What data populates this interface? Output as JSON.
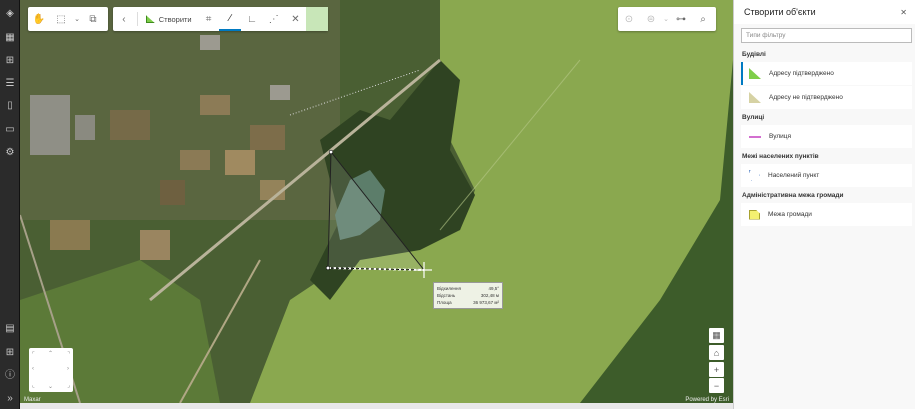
{
  "window": {
    "title": "Створити об'єкти"
  },
  "toolbar_create": {
    "label": "Створити"
  },
  "panel": {
    "title": "Створити об'єкти",
    "close_icon": "close-icon",
    "filter_placeholder": "Типи фільтру",
    "groups": [
      {
        "name": "Будівлі",
        "items": [
          {
            "label": "Адресу підтверджено",
            "swatch": "#7fce4a",
            "selected": true
          },
          {
            "label": "Адресу не підтверджено",
            "swatch": "#d6d2a4",
            "selected": false
          }
        ]
      },
      {
        "name": "Вулиці",
        "items": [
          {
            "label": "Вулиця",
            "swatch": "#d36fd0"
          }
        ]
      },
      {
        "name": "Межі населених пунктів",
        "items": [
          {
            "label": "Населений пункт",
            "swatch": "#4b7cc4"
          }
        ]
      },
      {
        "name": "Адміністративна межа громади",
        "items": [
          {
            "label": "Межа громади",
            "swatch": "#f4f070"
          }
        ]
      }
    ]
  },
  "measure": {
    "rows": [
      {
        "k": "Відхилення",
        "v": "49,5°"
      },
      {
        "k": "Відстань",
        "v": "302,48 м"
      },
      {
        "k": "Площа",
        "v": "36 973,67 м²"
      }
    ]
  },
  "map": {
    "attribution_left": "Maxar",
    "attribution_right": "Powered by Esri"
  },
  "colors": {
    "accent": "#007ac2",
    "confirmed": "#7fce4a"
  }
}
